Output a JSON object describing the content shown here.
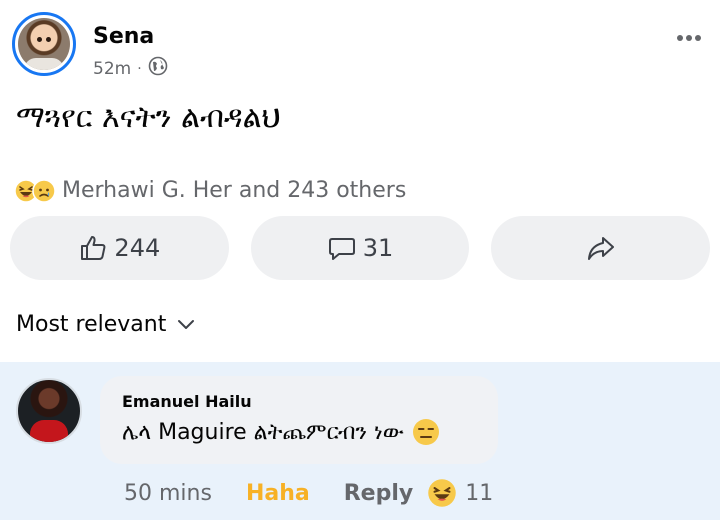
{
  "post": {
    "author": "Sena",
    "time": "52m",
    "separator": "·",
    "audience_icon": "globe-icon",
    "text": "ማጓየር እናትን ልብዳልህ",
    "reactions": {
      "icons": [
        "haha-icon",
        "sad-icon"
      ],
      "summary": "Merhawi G. Her and 243 others"
    },
    "actions": {
      "like_count": "244",
      "comment_count": "31",
      "share_icon": "share-icon"
    }
  },
  "comments": {
    "sort_label": "Most relevant",
    "items": [
      {
        "author": "Emanuel Hailu",
        "text": "ሌላ Maguire ልትጨምርብን ነው",
        "emoji": "expressionless-face-icon",
        "time": "50 mins",
        "reaction_label": "Haha",
        "reply_label": "Reply",
        "reaction_count": "11"
      }
    ]
  },
  "colors": {
    "accent": "#1877f2",
    "haha": "#f7b125",
    "secondary_text": "#65676b",
    "highlight_bg": "#e9f2fb"
  }
}
